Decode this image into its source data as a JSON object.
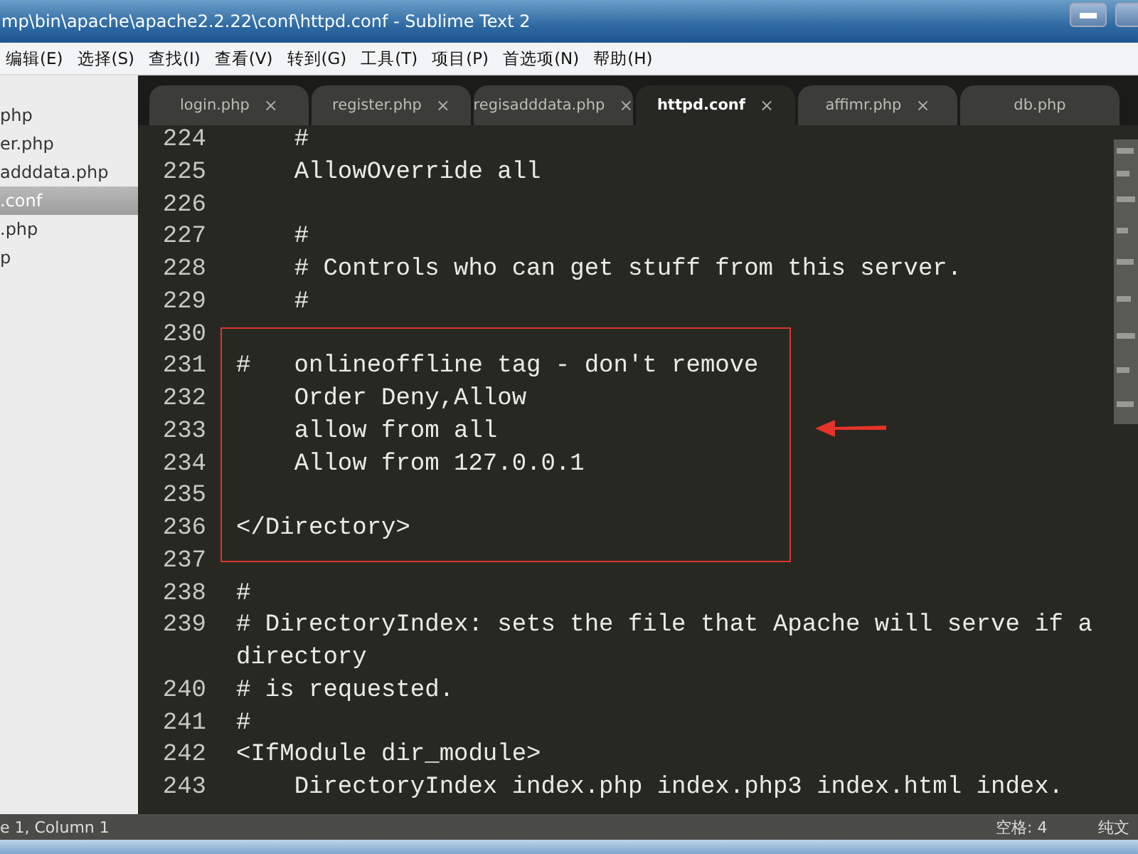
{
  "window": {
    "title": "mp\\bin\\apache\\apache2.2.22\\conf\\httpd.conf - Sublime Text 2"
  },
  "menu": [
    "编辑(E)",
    "选择(S)",
    "查找(I)",
    "查看(V)",
    "转到(G)",
    "工具(T)",
    "项目(P)",
    "首选项(N)",
    "帮助(H)"
  ],
  "sidebar": {
    "items": [
      {
        "label": "php",
        "selected": false
      },
      {
        "label": "er.php",
        "selected": false
      },
      {
        "label": "adddata.php",
        "selected": false
      },
      {
        "label": ".conf",
        "selected": true
      },
      {
        "label": ".php",
        "selected": false
      },
      {
        "label": "p",
        "selected": false
      }
    ]
  },
  "tabs": [
    {
      "label": "login.php",
      "selected": false,
      "closable": true
    },
    {
      "label": "register.php",
      "selected": false,
      "closable": true
    },
    {
      "label": "regisadddata.php",
      "selected": false,
      "closable": true
    },
    {
      "label": "httpd.conf",
      "selected": true,
      "closable": true
    },
    {
      "label": "affimr.php",
      "selected": false,
      "closable": true
    },
    {
      "label": "db.php",
      "selected": false,
      "closable": false
    }
  ],
  "tab_close": "×",
  "editor": {
    "lines": [
      {
        "number": "224",
        "text": "    #"
      },
      {
        "number": "225",
        "text": "    AllowOverride all"
      },
      {
        "number": "226"
      },
      {
        "number": "227",
        "text": "    #"
      },
      {
        "number": "228",
        "text": "    # Controls who can get stuff from this server."
      },
      {
        "number": "229",
        "text": "    #"
      },
      {
        "number": "230"
      },
      {
        "number": "231",
        "text": "#   onlineoffline tag - don't remove"
      },
      {
        "number": "232",
        "text": "    Order Deny,Allow"
      },
      {
        "number": "233",
        "text": "    allow from all"
      },
      {
        "number": "234",
        "text": "    Allow from 127.0.0.1"
      },
      {
        "number": "235"
      },
      {
        "number": "236",
        "text": "</Directory>"
      },
      {
        "number": "237"
      },
      {
        "number": "238",
        "text": "#"
      },
      {
        "number": "239",
        "text": "# DirectoryIndex: sets the file that Apache will serve if a directory"
      },
      {
        "number": "240",
        "text": "# is requested."
      },
      {
        "number": "241",
        "text": "#"
      },
      {
        "number": "242",
        "text": "<IfModule dir_module>"
      },
      {
        "number": "243",
        "text": "    DirectoryIndex index.php index.php3 index.html index."
      }
    ]
  },
  "status_bar": {
    "position": "e 1, Column 1",
    "indent": "空格: 4",
    "syntax": "纯文"
  }
}
